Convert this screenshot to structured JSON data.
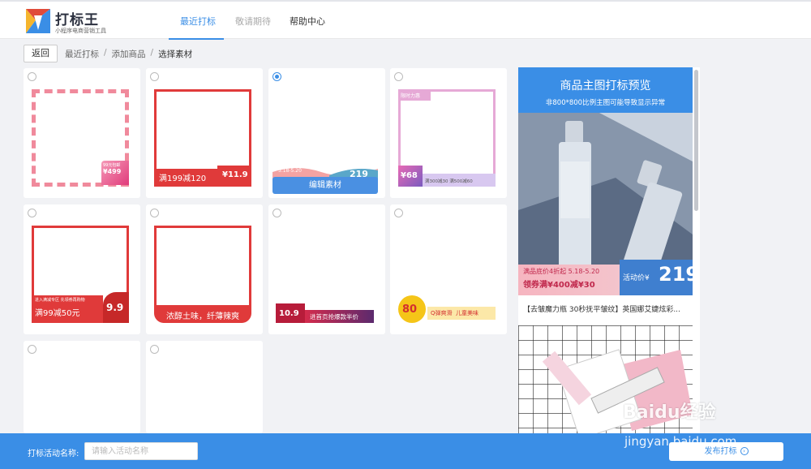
{
  "header": {
    "brand": "打标王",
    "brand_sub": "小程序电商营销工具",
    "tabs": [
      {
        "label": "最近打标",
        "state": "active"
      },
      {
        "label": "敬请期待",
        "state": "disabled"
      },
      {
        "label": "帮助中心",
        "state": "normal"
      }
    ]
  },
  "breadcrumb": {
    "back": "返回",
    "items": [
      "最近打标",
      "添加商品",
      "选择素材"
    ],
    "separator": "/"
  },
  "cards": [
    {
      "selected": false,
      "tags": [
        "99元包邮",
        "¥499"
      ]
    },
    {
      "selected": false,
      "tags": [
        "满199减120",
        "¥11.9"
      ]
    },
    {
      "selected": true,
      "tags": [
        "5.18-5.20",
        "219"
      ],
      "edit_label": "编辑素材"
    },
    {
      "selected": false,
      "tags": [
        "限时力惠",
        "¥68",
        "满300减30 满500减60"
      ]
    },
    {
      "selected": false,
      "tags": [
        "进入满减专区 先领券再购物",
        "满99减50元",
        "9.9"
      ]
    },
    {
      "selected": false,
      "tags": [
        "浓醇土味，纤薄辣爽"
      ]
    },
    {
      "selected": false,
      "tags": [
        "10.9",
        "进首页抢爆款半价"
      ]
    },
    {
      "selected": false,
      "tags": [
        "80",
        "Q弹爽滑",
        "儿童美味"
      ]
    },
    {
      "selected": false,
      "tags": []
    },
    {
      "selected": false,
      "tags": []
    }
  ],
  "preview": {
    "title": "商品主图打标预览",
    "subtitle": "非800*800比例主图可能导致显示异常",
    "banner_line1": "满品底价4折起  5.18-5.20",
    "banner_line2": "领券满¥400减¥30",
    "price_label": "活动价¥",
    "price": "219",
    "caption": "【去皱魔力瓶 30秒抚平皱纹】英国娜艾婕炫彩..."
  },
  "bottom": {
    "label": "打标活动名称:",
    "input_placeholder": "请输入活动名称",
    "input_value": "",
    "publish": "发布打标",
    "publish_icon": "arrow-circle-icon"
  },
  "watermark": {
    "text": "Baidu经验",
    "sub": "jingyan.baidu.com"
  },
  "colors": {
    "primary": "#3a8ee6",
    "red": "#e03a3a",
    "pink": "#ee5a8a",
    "purple": "#7a5bbf"
  }
}
